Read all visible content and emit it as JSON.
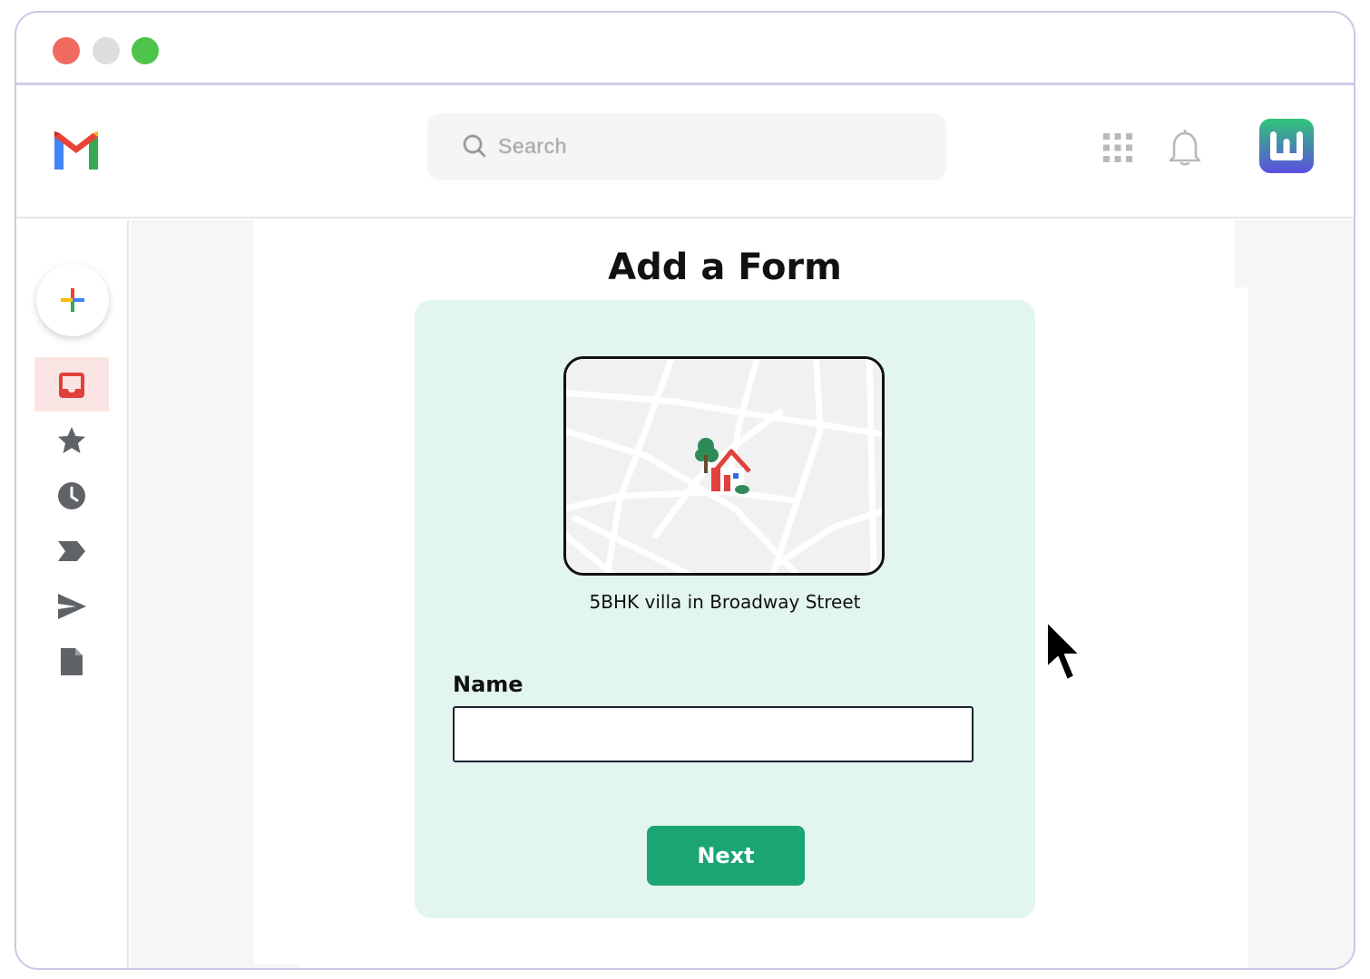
{
  "window": {
    "controls": [
      "close",
      "minimize",
      "maximize"
    ]
  },
  "appbar": {
    "logo_icon": "gmail-logo-icon",
    "search": {
      "placeholder": "Search",
      "icon": "search-icon"
    },
    "icons": [
      "apps-grid-icon",
      "bell-icon",
      "brand-avatar-icon"
    ]
  },
  "sidebar": {
    "compose_icon": "plus-icon",
    "items": [
      {
        "icon": "inbox-icon",
        "active": true
      },
      {
        "icon": "star-icon",
        "active": false
      },
      {
        "icon": "clock-icon",
        "active": false
      },
      {
        "icon": "label-icon",
        "active": false
      },
      {
        "icon": "send-icon",
        "active": false
      },
      {
        "icon": "file-icon",
        "active": false
      }
    ]
  },
  "form": {
    "title": "Add a Form",
    "map_icon": "map-house-icon",
    "property_label": "5BHK villa in Broadway Street",
    "name_label": "Name",
    "name_value": "",
    "next_label": "Next"
  },
  "colors": {
    "card_bg": "#e2f5ee",
    "button_bg": "#1aa572",
    "active_nav_bg": "#fbe4e4",
    "window_border": "#cbc6e6"
  }
}
